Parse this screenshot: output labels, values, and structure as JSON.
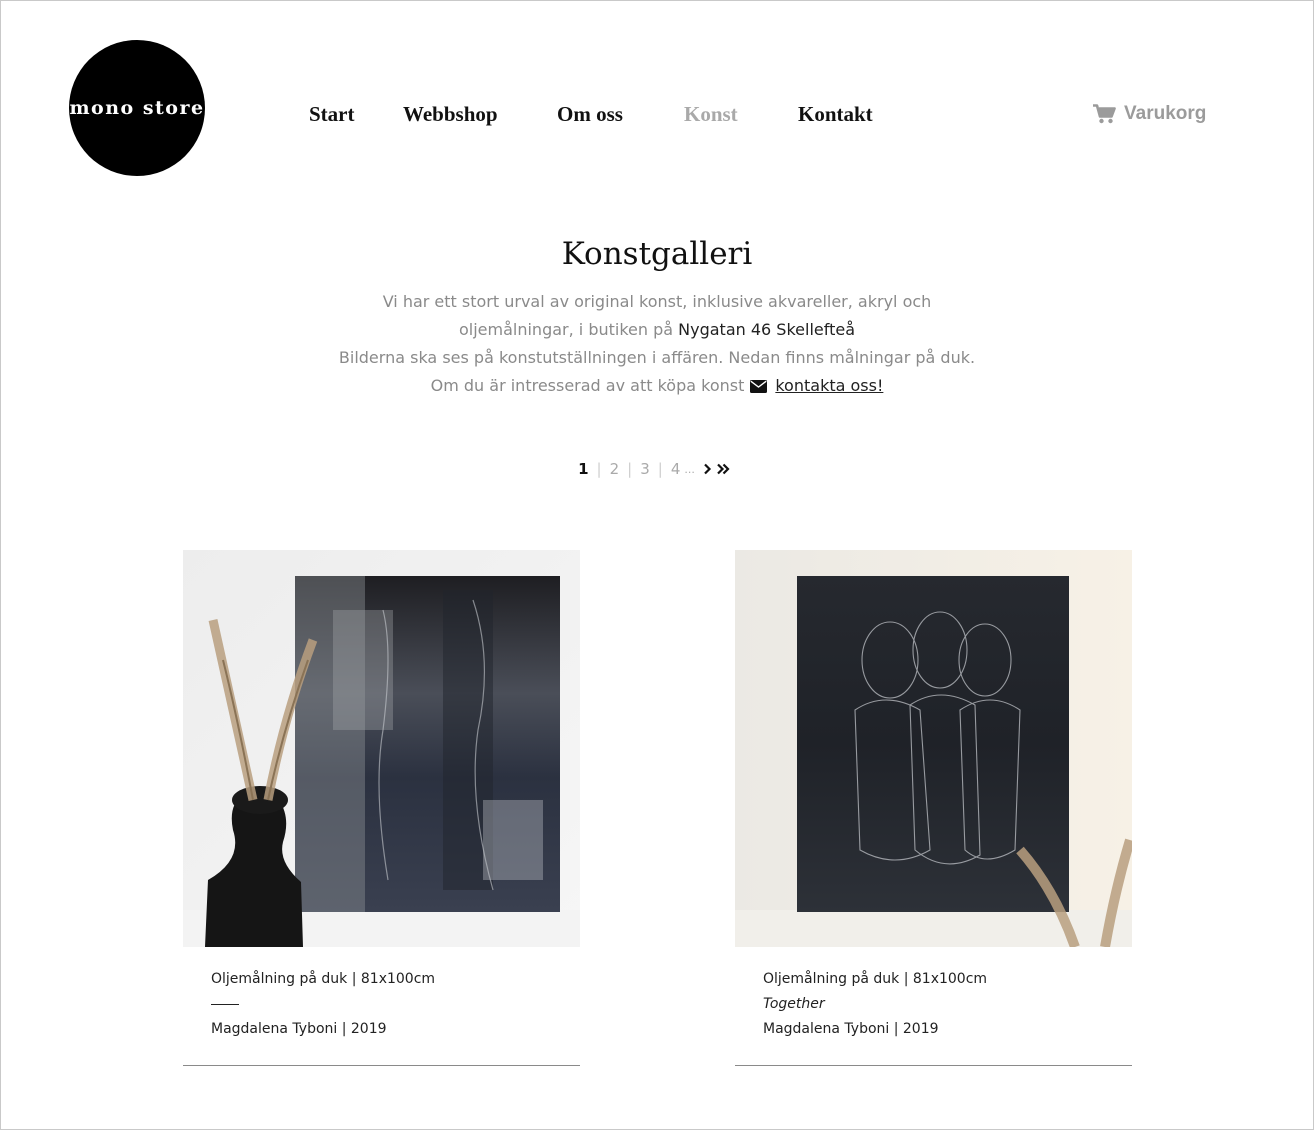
{
  "header": {
    "logo_text": "mono store",
    "nav": [
      {
        "label": "Start",
        "active": false
      },
      {
        "label": "Webbshop",
        "active": false
      },
      {
        "label": "Om oss",
        "active": false
      },
      {
        "label": "Konst",
        "active": true
      },
      {
        "label": "Kontakt",
        "active": false
      }
    ],
    "cart_label": "Varukorg",
    "cart_icon": "shopping-cart-icon"
  },
  "intro": {
    "title": "Konstgalleri",
    "line1": "Vi har ett stort urval av original konst, inklusive akvareller, akryl och",
    "line2_prefix": "oljemålningar, i butiken på",
    "line2_address": "Nygatan 46 Skellefteå",
    "line3": "Bilderna ska ses på konstutställningen i affären. Nedan finns målningar på duk.",
    "line4_prefix": "Om du är intresserad av att köpa konst",
    "contact_link": "kontakta oss!",
    "mail_icon": "envelope-icon"
  },
  "pagination": {
    "pages": [
      "1",
      "2",
      "3",
      "4"
    ],
    "current": "1",
    "ellipsis": "..."
  },
  "artworks": [
    {
      "medium": "Oljemålning på duk | 81x100cm",
      "title": "",
      "artist_year": "Magdalena Tyboni | 2019"
    },
    {
      "medium": "Oljemålning på duk | 81x100cm",
      "title": "Together",
      "artist_year": "Magdalena Tyboni | 2019"
    }
  ],
  "colors": {
    "text": "#111111",
    "muted": "#8a8a8a",
    "active_nav": "#a9a9a9",
    "logo_bg": "#000000"
  }
}
